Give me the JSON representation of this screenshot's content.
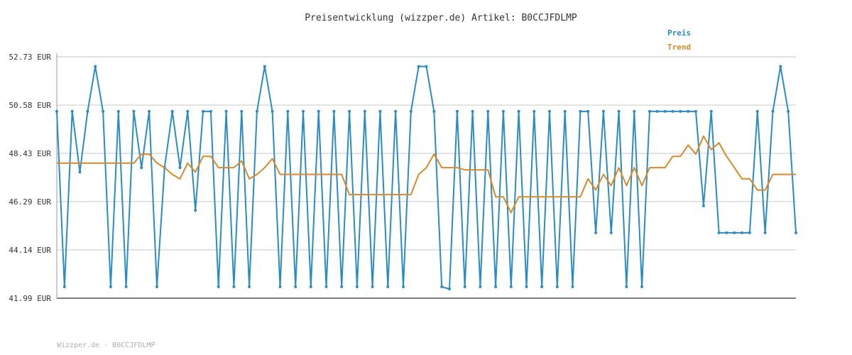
{
  "chart_data": {
    "type": "line",
    "title": "Preisentwicklung (wizzper.de) Artikel: B0CCJFDLMP",
    "xlabel": "",
    "ylabel": "",
    "ylim": [
      41.99,
      52.73
    ],
    "y_ticks": [
      "52.73 EUR",
      "50.58 EUR",
      "48.43 EUR",
      "46.29 EUR",
      "44.14 EUR",
      "41.99 EUR"
    ],
    "y_tick_values": [
      52.73,
      50.58,
      48.43,
      46.29,
      44.14,
      41.99
    ],
    "grid": true,
    "legend_position": "top-right",
    "series": [
      {
        "name": "Preis",
        "color": "#2b8cc4",
        "values": [
          50.3,
          42.5,
          50.3,
          47.6,
          50.3,
          52.3,
          50.3,
          42.5,
          50.3,
          42.5,
          50.3,
          47.8,
          50.3,
          42.5,
          47.8,
          50.3,
          47.8,
          50.3,
          45.9,
          50.3,
          50.3,
          42.5,
          50.3,
          42.5,
          50.3,
          42.5,
          50.3,
          52.3,
          50.3,
          42.5,
          50.3,
          42.5,
          50.3,
          42.5,
          50.3,
          42.5,
          50.3,
          42.5,
          50.3,
          42.5,
          50.3,
          42.5,
          50.3,
          42.5,
          50.3,
          42.5,
          50.3,
          52.3,
          52.3,
          50.3,
          42.5,
          42.4,
          50.3,
          42.5,
          50.3,
          42.5,
          50.3,
          42.5,
          50.3,
          42.5,
          50.3,
          42.5,
          50.3,
          42.5,
          50.3,
          42.5,
          50.3,
          42.5,
          50.3,
          50.3,
          44.9,
          50.3,
          44.9,
          50.3,
          42.5,
          50.3,
          42.5,
          50.3,
          50.3,
          50.3,
          50.3,
          50.3,
          50.3,
          50.3,
          46.1,
          50.3,
          44.9,
          44.9,
          44.9,
          44.9,
          44.9,
          50.3,
          44.9,
          50.3,
          52.3,
          50.3,
          44.9
        ]
      },
      {
        "name": "Trend",
        "color": "#d88a2a",
        "values": [
          48.0,
          48.0,
          48.0,
          48.0,
          48.0,
          48.0,
          48.0,
          48.0,
          48.0,
          48.0,
          48.0,
          48.4,
          48.4,
          48.0,
          47.8,
          47.5,
          47.3,
          48.0,
          47.6,
          48.3,
          48.3,
          47.8,
          47.8,
          47.8,
          48.1,
          47.3,
          47.5,
          47.8,
          48.2,
          47.5,
          47.5,
          47.5,
          47.5,
          47.5,
          47.5,
          47.5,
          47.5,
          47.5,
          46.6,
          46.6,
          46.6,
          46.6,
          46.6,
          46.6,
          46.6,
          46.6,
          46.6,
          47.5,
          47.8,
          48.4,
          47.8,
          47.8,
          47.8,
          47.7,
          47.7,
          47.7,
          47.7,
          46.5,
          46.5,
          45.8,
          46.5,
          46.5,
          46.5,
          46.5,
          46.5,
          46.5,
          46.5,
          46.5,
          46.5,
          47.3,
          46.8,
          47.5,
          47.0,
          47.8,
          47.0,
          47.8,
          47.0,
          47.8,
          47.8,
          47.8,
          48.3,
          48.3,
          48.8,
          48.4,
          49.2,
          48.6,
          48.9,
          48.3,
          47.8,
          47.3,
          47.3,
          46.8,
          46.8,
          47.5,
          47.5,
          47.5,
          47.5
        ]
      }
    ]
  },
  "footer": "Wizzper.de - B0CCJFDLMP"
}
